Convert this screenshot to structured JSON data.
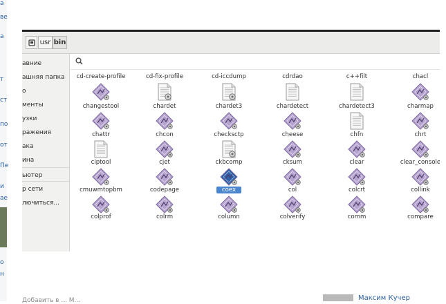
{
  "background": {
    "left_fragments": [
      "а",
      "ве",
      "а",
      "т",
      "ст",
      "по",
      "от",
      "Пе",
      "и",
      "ае",
      "о",
      "н"
    ]
  },
  "window": {
    "path": [
      {
        "label": "",
        "icon": "disk-icon"
      },
      {
        "label": "usr"
      },
      {
        "label": "bin"
      }
    ],
    "search_placeholder": "",
    "sidebar": [
      "авние",
      "ашняя папка",
      "о",
      "менты",
      "узки",
      "ражения",
      "ака",
      "ина",
      "ьютер",
      "р сети",
      "лючиться..."
    ],
    "top_row": [
      "cd-create-profile",
      "cd-fix-profile",
      "cd-iccdump",
      "cdrdao",
      "c++filt",
      "chacl"
    ],
    "files": [
      {
        "name": "changestool",
        "type": "exec"
      },
      {
        "name": "chardet",
        "type": "script"
      },
      {
        "name": "chardet3",
        "type": "script"
      },
      {
        "name": "chardetect",
        "type": "text"
      },
      {
        "name": "chardetect3",
        "type": "text"
      },
      {
        "name": "charmap",
        "type": "exec"
      },
      {
        "name": "chattr",
        "type": "exec"
      },
      {
        "name": "chcon",
        "type": "exec"
      },
      {
        "name": "checksctp",
        "type": "exec"
      },
      {
        "name": "cheese",
        "type": "exec"
      },
      {
        "name": "chfn",
        "type": "text"
      },
      {
        "name": "chrt",
        "type": "exec"
      },
      {
        "name": "ciptool",
        "type": "text"
      },
      {
        "name": "cjet",
        "type": "exec"
      },
      {
        "name": "ckbcomp",
        "type": "script"
      },
      {
        "name": "cksum",
        "type": "exec"
      },
      {
        "name": "clear",
        "type": "exec"
      },
      {
        "name": "clear_console",
        "type": "exec"
      },
      {
        "name": "cmuwmtopbm",
        "type": "exec"
      },
      {
        "name": "codepage",
        "type": "exec"
      },
      {
        "name": "coex",
        "type": "exec",
        "selected": true
      },
      {
        "name": "col",
        "type": "exec"
      },
      {
        "name": "colcrt",
        "type": "exec"
      },
      {
        "name": "collink",
        "type": "exec"
      },
      {
        "name": "colprof",
        "type": "exec"
      },
      {
        "name": "colrm",
        "type": "exec"
      },
      {
        "name": "column",
        "type": "exec"
      },
      {
        "name": "colverify",
        "type": "exec"
      },
      {
        "name": "comm",
        "type": "exec"
      },
      {
        "name": "compare",
        "type": "exec"
      }
    ]
  },
  "bottom": {
    "right_name": "Максим Кучер",
    "left_text": "Добавить в ... М..."
  },
  "colors": {
    "exec_diamond": "#b7a3cf",
    "selected_diamond": "#2f5fa8",
    "selection": "#4a86cf",
    "link": "#2a5fa0"
  }
}
